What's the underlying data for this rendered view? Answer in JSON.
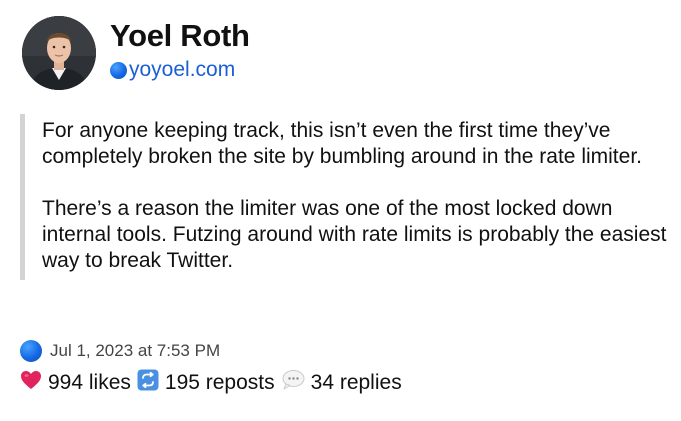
{
  "post": {
    "author": {
      "name": "Yoel Roth",
      "handle": "yoyoel.com"
    },
    "paragraphs": [
      "For anyone keeping track, this isn’t even the first time they’ve completely broken the site by bumbling around in the rate limiter.",
      "There’s a reason the limiter was one of the most locked down internal tools. Futzing around with rate limits is probably the easiest way to break Twitter."
    ],
    "date": "Jul 1, 2023 at 7:53 PM",
    "stats": {
      "likes": "994 likes",
      "reposts": "195 reposts",
      "replies": "34 replies"
    }
  },
  "icons": {
    "verified": "blue-circle-icon",
    "likes": "red-heart-icon",
    "reposts": "repost-arrows-icon",
    "replies": "speech-bubble-icon"
  },
  "colors": {
    "handle": "#1a5fd6",
    "blue_dot": "#1668e3",
    "heart": "#e0245e",
    "repost": "#4a90e2",
    "quote_border": "#d3d3d3"
  }
}
